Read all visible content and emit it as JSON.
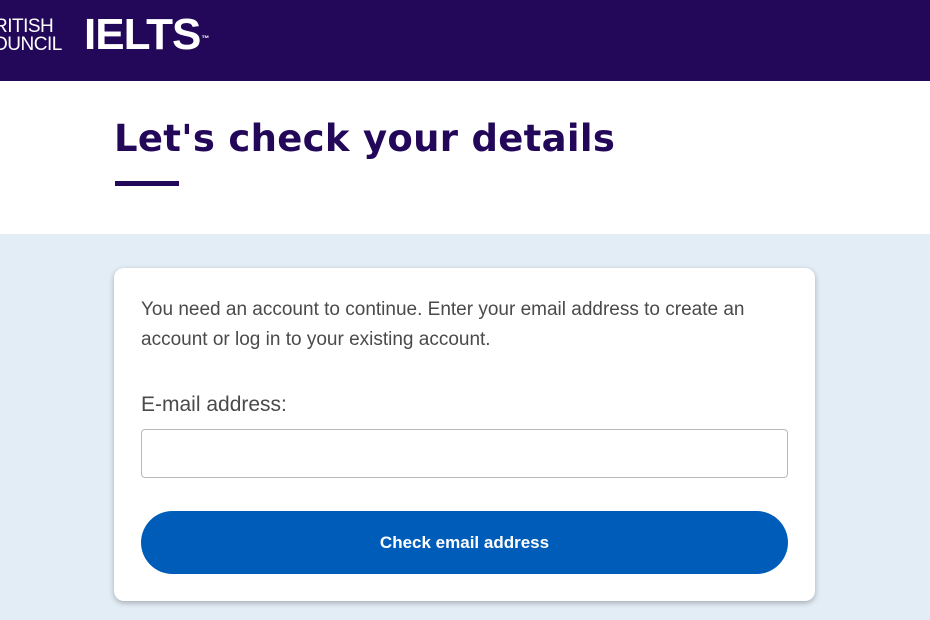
{
  "header": {
    "british_council_line1": "RITISH",
    "british_council_line2": "OUNCIL",
    "ielts_logo": "IELTS",
    "ielts_trademark": "™"
  },
  "main": {
    "title": "Let's check your details"
  },
  "form": {
    "intro_text": "You need an account to continue. Enter your email address to create an account or log in to your existing account.",
    "email_label": "E-mail address:",
    "email_value": "",
    "email_placeholder": "",
    "submit_label": "Check email address"
  },
  "colors": {
    "header_bg": "#23085a",
    "title": "#23085a",
    "page_bg": "#e3edf6",
    "button_bg": "#005cb9"
  }
}
